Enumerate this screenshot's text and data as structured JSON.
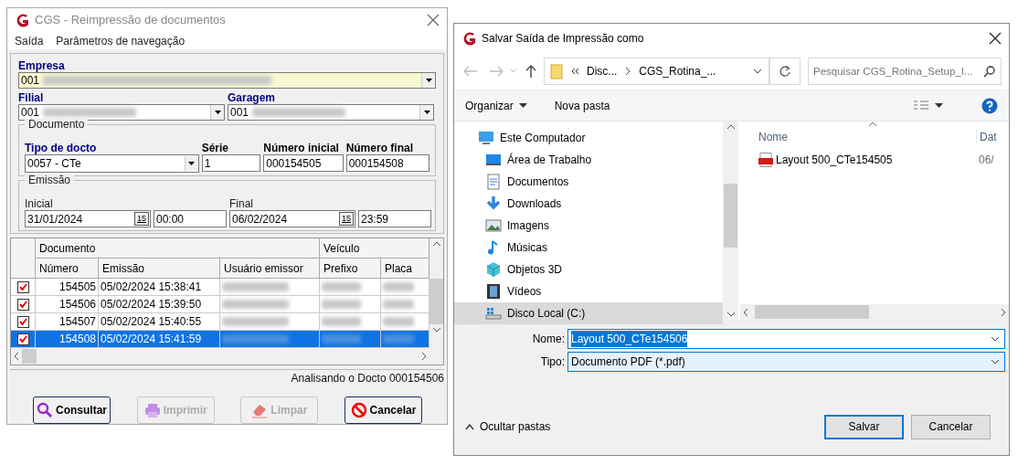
{
  "left_window": {
    "title": "CGS - Reimpressão de documentos",
    "menu": [
      "Saída",
      "Parâmetros de navegação"
    ],
    "empresa": {
      "label": "Empresa",
      "value": "001"
    },
    "filial": {
      "label": "Filial",
      "value": "001"
    },
    "garagem": {
      "label": "Garagem",
      "value": "001"
    },
    "documento": {
      "legend": "Documento",
      "fields": [
        {
          "label": "Tipo de docto",
          "value": "0057 - CTe",
          "kind": "combo"
        },
        {
          "label": "Série",
          "value": "1",
          "kind": "text"
        },
        {
          "label": "Número inicial",
          "value": "000154505",
          "kind": "text"
        },
        {
          "label": "Número final",
          "value": "000154508",
          "kind": "text"
        }
      ]
    },
    "emissao": {
      "legend": "Emissão",
      "ranges": [
        {
          "label": "Inicial",
          "date": "31/01/2024",
          "calendar": "15",
          "time": "00:00"
        },
        {
          "label": "Final",
          "date": "06/02/2024",
          "calendar": "15",
          "time": "23:59"
        }
      ]
    },
    "grid": {
      "group_headers": [
        "Documento",
        "Veículo"
      ],
      "columns": [
        "Número",
        "Emissão",
        "Usuário emissor",
        "Prefixo",
        "Placa"
      ],
      "rows": [
        {
          "checked": true,
          "selected": false,
          "numero": "154505",
          "emissao": "05/02/2024 15:38:41"
        },
        {
          "checked": true,
          "selected": false,
          "numero": "154506",
          "emissao": "05/02/2024 15:39:50"
        },
        {
          "checked": true,
          "selected": false,
          "numero": "154507",
          "emissao": "05/02/2024 15:40:55"
        },
        {
          "checked": true,
          "selected": true,
          "numero": "154508",
          "emissao": "05/02/2024 15:41:59"
        }
      ]
    },
    "status": "Analisando o Docto 000154506",
    "buttons": [
      {
        "label": "Consultar",
        "kind": "search",
        "disabled": false
      },
      {
        "label": "Imprimir",
        "kind": "print",
        "disabled": true
      },
      {
        "label": "Limpar",
        "kind": "eraser",
        "disabled": true
      },
      {
        "label": "Cancelar",
        "kind": "cancel",
        "disabled": false
      }
    ]
  },
  "save_dialog": {
    "title": "Salvar Saída de Impressão como",
    "breadcrumb": [
      "Disc...",
      "CGS_Rotina_..."
    ],
    "search": {
      "placeholder": "Pesquisar CGS_Rotina_Setup_I..."
    },
    "toolbar": [
      "Organizar",
      "Nova pasta"
    ],
    "nav": [
      {
        "label": "Este Computador",
        "kind": "computer",
        "selected": false,
        "children": [
          {
            "label": "Área de Trabalho",
            "kind": "desktop",
            "selected": false
          },
          {
            "label": "Documentos",
            "kind": "document",
            "selected": false
          },
          {
            "label": "Downloads",
            "kind": "download",
            "selected": false
          },
          {
            "label": "Imagens",
            "kind": "image",
            "selected": false
          },
          {
            "label": "Músicas",
            "kind": "music",
            "selected": false
          },
          {
            "label": "Objetos 3D",
            "kind": "cube",
            "selected": false
          },
          {
            "label": "Vídeos",
            "kind": "video",
            "selected": false
          },
          {
            "label": "Disco Local (C:)",
            "kind": "drive",
            "selected": true
          }
        ]
      }
    ],
    "columns": [
      "Nome",
      "Dat"
    ],
    "files": [
      {
        "name": "Layout 500_CTe154505",
        "date": "06/"
      }
    ],
    "fields": [
      {
        "label": "Nome:",
        "value": "Layout 500_CTe154506",
        "selected": true
      },
      {
        "label": "Tipo:",
        "value": "Documento PDF (*.pdf)",
        "selected": false
      }
    ],
    "hide_folders": "Ocultar pastas",
    "buttons": [
      {
        "label": "Salvar",
        "default": true
      },
      {
        "label": "Cancelar",
        "default": false
      }
    ]
  }
}
